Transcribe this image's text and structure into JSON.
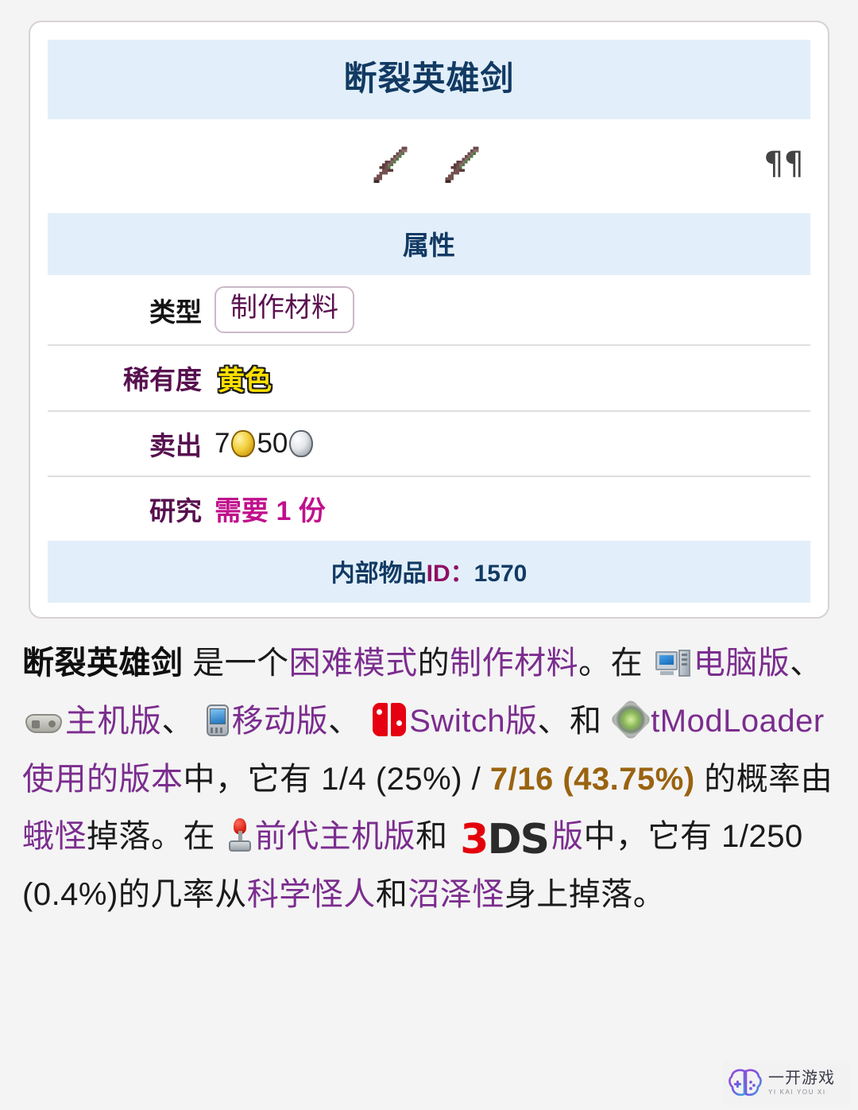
{
  "infobox": {
    "title": "断裂英雄剑",
    "sprite_icon": "broken-hero-sword-sprite",
    "corner_glyphs": "¶¶",
    "subhead": "属性",
    "rows": [
      {
        "label": "类型",
        "value": "制作材料",
        "kind": "pill"
      },
      {
        "label": "稀有度",
        "value": "黄色",
        "kind": "rarity"
      },
      {
        "label": "卖出",
        "gold": "7",
        "silver": "50",
        "kind": "coins"
      },
      {
        "label": "研究",
        "value": "需要 1 份",
        "kind": "research"
      }
    ],
    "footer": {
      "label": "内部物品",
      "id_label": "ID：",
      "id_value": "1570"
    }
  },
  "prose": {
    "t1": "断裂英雄剑",
    "t2": " 是一个",
    "t3": "困难模式",
    "t4": "的",
    "t5": "制作材料",
    "t6": "。在 ",
    "t7": "电脑版",
    "t8": "、 ",
    "t9": "主机版",
    "t10": "、 ",
    "t11": "移动版",
    "t12": "、 ",
    "t13": "Switch版",
    "t14": "、和 ",
    "t15": "tModLoader使用的版本",
    "t16": "中，它有 ",
    "t17": "1/4 (25%) / ",
    "t18": "7/16 (43.75%)",
    "t19": " 的概率由",
    "t20": "蛾怪",
    "t21": "掉落。在 ",
    "t22": "前代主机版",
    "t23": "和 ",
    "t24": "3",
    "t25": "DS",
    "t26": "版",
    "t27": "中，它有 1/250 (0.4%)的几率从",
    "t28": "科学怪人",
    "t29": "和",
    "t30": "沼泽怪",
    "t31": "身上掉落。"
  },
  "icons": {
    "desktop": "desktop-computer-icon",
    "gamepad": "gamepad-icon",
    "mobile": "mobile-phone-icon",
    "switch": "nintendo-switch-icon",
    "tmodloader": "tmodloader-icon",
    "joystick": "joystick-icon",
    "ds": "3ds-logo-icon"
  },
  "watermark": {
    "main": "一开游戏",
    "sub": "YI KAI YOU XI"
  },
  "colors": {
    "header_band": "#e2effa",
    "header_text": "#123a63",
    "link_purple": "#7b2d8e",
    "label_purple": "#57104f",
    "research_pink": "#c0108c",
    "rate_gold": "#9a6310",
    "rarity_yellow": "#ffe000"
  }
}
